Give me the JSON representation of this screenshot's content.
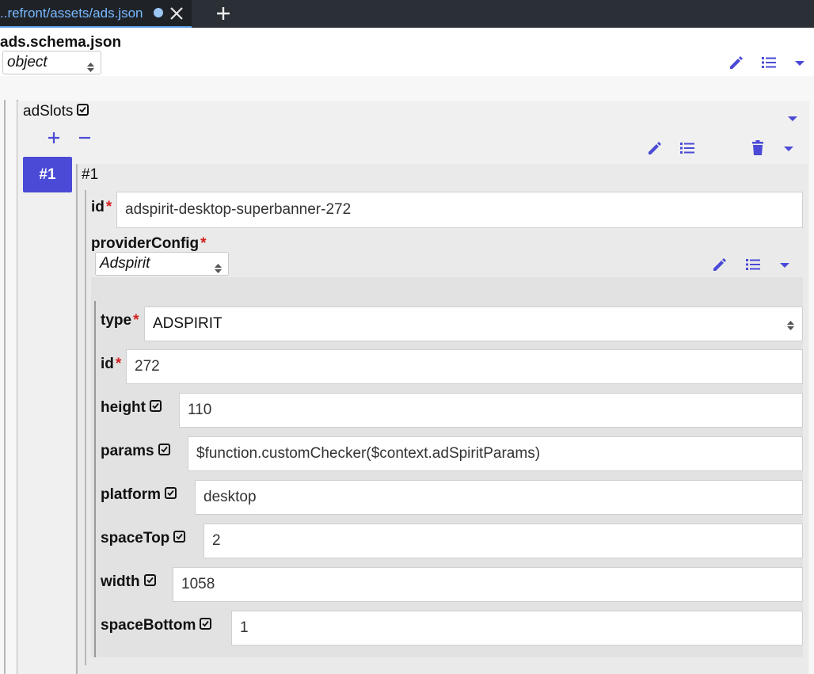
{
  "tab": {
    "title": "..refront/assets/ads.json",
    "close_icon": "close-icon",
    "new_tab_icon": "plus-icon"
  },
  "header": {
    "schema_title": "ads.schema.json",
    "type_select": "object"
  },
  "adSlots": {
    "label": "adSlots",
    "item_index": "#1",
    "item_title": "#1",
    "id_label": "id",
    "id_value": "adspirit-desktop-superbanner-272",
    "provider_label": "providerConfig",
    "provider_select": "Adspirit",
    "fields": [
      {
        "label": "type",
        "value": "ADSPIRIT",
        "required": true,
        "checkbox": false,
        "select": true
      },
      {
        "label": "id",
        "value": "272",
        "required": true,
        "checkbox": false
      },
      {
        "label": "height",
        "value": "110",
        "required": false,
        "checkbox": true
      },
      {
        "label": "params",
        "value": "$function.customChecker($context.adSpiritParams)",
        "required": false,
        "checkbox": true
      },
      {
        "label": "platform",
        "value": "desktop",
        "required": false,
        "checkbox": true
      },
      {
        "label": "spaceTop",
        "value": "2",
        "required": false,
        "checkbox": true
      },
      {
        "label": "width",
        "value": "1058",
        "required": false,
        "checkbox": true
      },
      {
        "label": "spaceBottom",
        "value": "1",
        "required": false,
        "checkbox": true
      }
    ]
  },
  "required_marker": "*",
  "colors": {
    "accent": "#4a4ad6",
    "tab_bar": "#2b2f36",
    "required": "#d21f1f",
    "panel_bg": "#f0f0f0"
  }
}
